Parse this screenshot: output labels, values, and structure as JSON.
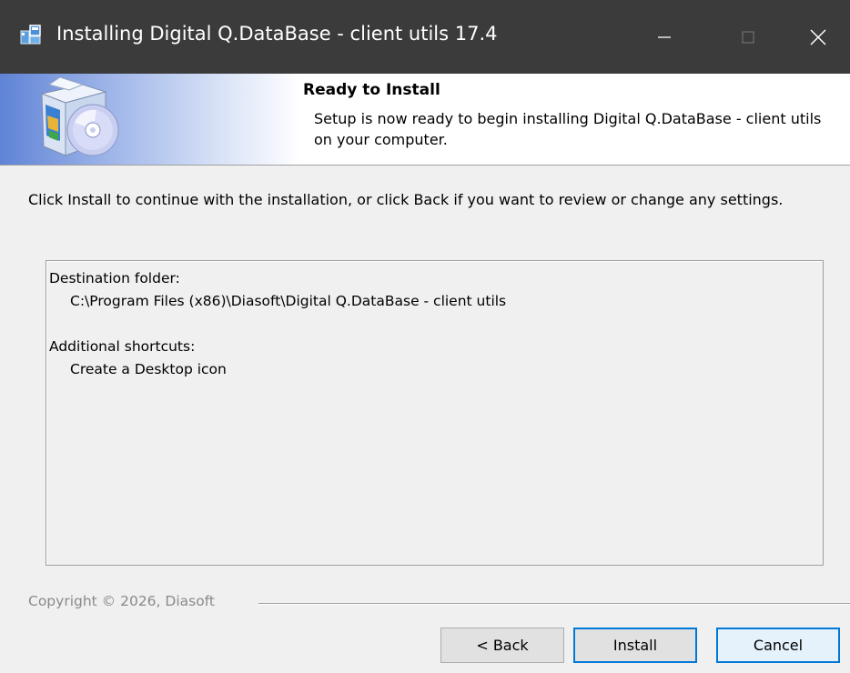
{
  "window": {
    "title": "Installing Digital Q.DataBase - client utils 17.4",
    "icons": {
      "app": "setup-icon",
      "minimize": "minimize-icon",
      "maximize": "maximize-icon",
      "close": "close-icon"
    }
  },
  "header": {
    "title": "Ready to Install",
    "subtitle": "Setup is now ready to begin installing Digital Q.DataBase - client utils on your computer.",
    "icon": "setup-box-cd-icon"
  },
  "body": {
    "intro": "Click Install to continue with the installation, or click Back if you want to review or change any settings.",
    "memo": {
      "destination_label": "Destination folder:",
      "destination_value": "C:\\Program Files (x86)\\Diasoft\\Digital Q.DataBase - client utils",
      "shortcuts_label": "Additional shortcuts:",
      "shortcuts_value": "Create a Desktop icon"
    }
  },
  "footer": {
    "copyright": "Copyright © 2026, Diasoft",
    "back_label": "< Back",
    "install_label": "Install",
    "cancel_label": "Cancel"
  },
  "colors": {
    "titlebar": "#3b3b3b",
    "accent": "#0078d7",
    "dialog_bg": "#f0f0f0"
  }
}
